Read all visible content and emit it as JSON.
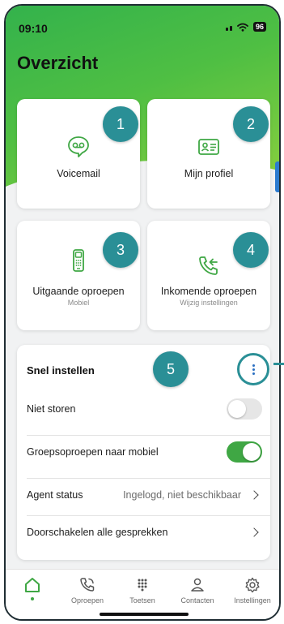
{
  "status_bar": {
    "time": "09:10",
    "battery": "96"
  },
  "page": {
    "title": "Overzicht"
  },
  "tiles": [
    {
      "label": "Voicemail",
      "subtitle": "",
      "badge": "1",
      "icon": "voicemail-icon"
    },
    {
      "label": "Mijn profiel",
      "subtitle": "",
      "badge": "2",
      "icon": "profile-card-icon"
    },
    {
      "label": "Uitgaande oproepen",
      "subtitle": "Mobiel",
      "badge": "3",
      "icon": "mobile-phone-icon"
    },
    {
      "label": "Inkomende oproepen",
      "subtitle": "Wijzig instellingen",
      "badge": "4",
      "icon": "incoming-call-icon"
    }
  ],
  "quick_settings": {
    "title": "Snel instellen",
    "badge": "5",
    "rows": [
      {
        "label": "Niet storen",
        "type": "toggle",
        "on": false
      },
      {
        "label": "Groepsoproepen naar mobiel",
        "type": "toggle",
        "on": true
      },
      {
        "label": "Agent status",
        "type": "link",
        "value": "Ingelogd, niet beschikbaar"
      },
      {
        "label": "Doorschakelen alle gesprekken",
        "type": "link",
        "value": ""
      }
    ]
  },
  "tabbar": {
    "items": [
      {
        "label": "",
        "icon": "home-icon",
        "active": true
      },
      {
        "label": "Oproepen",
        "icon": "phone-calls-icon",
        "active": false
      },
      {
        "label": "Toetsen",
        "icon": "keypad-icon",
        "active": false
      },
      {
        "label": "Contacten",
        "icon": "contacts-icon",
        "active": false
      },
      {
        "label": "Instellingen",
        "icon": "settings-gear-icon",
        "active": false
      }
    ]
  },
  "colors": {
    "brand_green": "#3fa744",
    "badge_teal": "#2a8f96",
    "accent_blue": "#2b6fc2"
  }
}
